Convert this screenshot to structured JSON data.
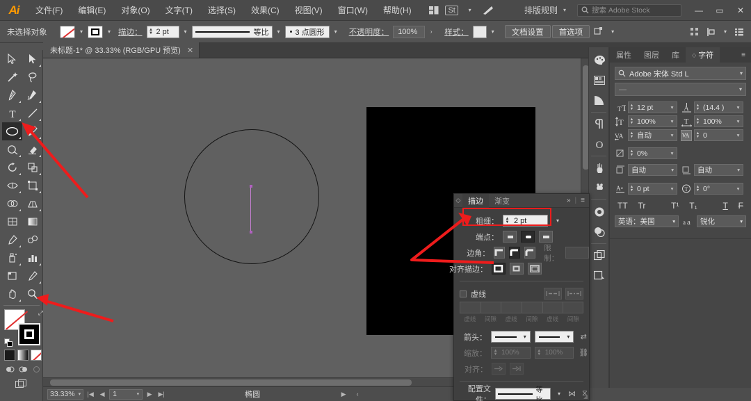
{
  "app": {
    "name": "Adobe Illustrator",
    "logo_text": "Ai"
  },
  "menubar": {
    "items": [
      {
        "label": "文件(F)"
      },
      {
        "label": "编辑(E)"
      },
      {
        "label": "对象(O)"
      },
      {
        "label": "文字(T)"
      },
      {
        "label": "选择(S)"
      },
      {
        "label": "效果(C)"
      },
      {
        "label": "视图(V)"
      },
      {
        "label": "窗口(W)"
      },
      {
        "label": "帮助(H)"
      }
    ],
    "workspace_icon": "arrange-documents-icon",
    "stock_icon": "stock-icon",
    "brush_icon": "brush-icon",
    "arrange_label": "排版规则",
    "search_placeholder": "搜索 Adobe Stock",
    "search_value": "",
    "window_controls": {
      "minimize": "—",
      "maximize": "▭",
      "close": "✕"
    }
  },
  "controlbar": {
    "selection_status": "未选择对象",
    "fill_label": "fill-none-swatch",
    "stroke_label": "stroke-black-swatch",
    "stroke_text": "描边：",
    "stroke_weight": "2 pt",
    "profile_label": "等比",
    "variable_width": "3 点圆形",
    "opacity_label": "不透明度：",
    "opacity_value": "100%",
    "style_label": "样式：",
    "doc_setup": "文档设置",
    "preferences": "首选项"
  },
  "document": {
    "tab_title": "未标题-1* @ 33.33% (RGB/GPU 预览)",
    "close_glyph": "✕"
  },
  "toolbar": {
    "tools": [
      {
        "name": "selection-tool",
        "active": false
      },
      {
        "name": "direct-selection-tool",
        "active": false
      },
      {
        "name": "magic-wand-tool",
        "active": false
      },
      {
        "name": "lasso-tool",
        "active": false
      },
      {
        "name": "pen-tool",
        "active": false
      },
      {
        "name": "curvature-tool",
        "active": false
      },
      {
        "name": "type-tool",
        "active": false
      },
      {
        "name": "line-segment-tool",
        "active": false
      },
      {
        "name": "ellipse-tool",
        "active": true
      },
      {
        "name": "paintbrush-tool",
        "active": false
      },
      {
        "name": "shaper-tool",
        "active": false
      },
      {
        "name": "eraser-tool",
        "active": false
      },
      {
        "name": "rotate-tool",
        "active": false
      },
      {
        "name": "scale-tool",
        "active": false
      },
      {
        "name": "width-tool",
        "active": false
      },
      {
        "name": "free-transform-tool",
        "active": false
      },
      {
        "name": "shape-builder-tool",
        "active": false
      },
      {
        "name": "perspective-grid-tool",
        "active": false
      },
      {
        "name": "mesh-tool",
        "active": false
      },
      {
        "name": "gradient-tool",
        "active": false
      },
      {
        "name": "eyedropper-tool",
        "active": false
      },
      {
        "name": "blend-tool",
        "active": false
      },
      {
        "name": "symbol-sprayer-tool",
        "active": false
      },
      {
        "name": "column-graph-tool",
        "active": false
      },
      {
        "name": "artboard-tool",
        "active": false
      },
      {
        "name": "slice-tool",
        "active": false
      },
      {
        "name": "hand-tool",
        "active": false
      },
      {
        "name": "zoom-tool",
        "active": false
      }
    ],
    "fill_swatch": "none",
    "stroke_swatch": "#000000",
    "color_modes": [
      "color-swatch",
      "gradient-swatch",
      "none-swatch"
    ],
    "screen_modes": [
      "draw-normal",
      "draw-behind",
      "draw-inside"
    ],
    "screen_mode_icon": "change-screen-mode-icon"
  },
  "canvas": {
    "artboard_color": "#000000",
    "circle_stroke": "#141414",
    "guide_color": "#c47fd0",
    "background": "#606060"
  },
  "statusbar": {
    "zoom_value": "33.33%",
    "page_value": "1",
    "current_tool": "椭圆",
    "first_glyph": "|◀",
    "prev_glyph": "◀",
    "next_glyph": "▶",
    "last_glyph": "▶|"
  },
  "stroke_panel": {
    "tab_active": "描边",
    "tab_inactive": "渐变",
    "collapse_glyph": "»",
    "menu_glyph": "≡",
    "weight_label": "粗细：",
    "weight_value": "2 pt",
    "cap_label": "端点：",
    "corner_label": "边角：",
    "limit_label": "限制：",
    "limit_value": "",
    "align_label": "对齐描边：",
    "dashed_label": "虚线",
    "dash_fields": [
      "虚线",
      "间隙",
      "虚线",
      "间隙",
      "虚线",
      "间隙"
    ],
    "arrows_label": "箭头：",
    "scale_label": "缩放：",
    "scale_value_1": "100%",
    "scale_value_2": "100%",
    "align_arrow_label": "对齐：",
    "profile_label": "配置文件：",
    "profile_value": "等比"
  },
  "right_panel": {
    "tabs": [
      {
        "label": "属性",
        "active": false
      },
      {
        "label": "图层",
        "active": false
      },
      {
        "label": "库",
        "active": false
      },
      {
        "label": "字符",
        "active": true
      }
    ],
    "menu_glyph": "≡",
    "font_family": "Adobe 宋体 Std L",
    "font_style": "—",
    "fields": [
      {
        "icon": "font-size-icon",
        "value": "12 pt"
      },
      {
        "icon": "leading-icon",
        "value": "(14.4 )"
      },
      {
        "icon": "vertical-scale-icon",
        "value": "100%"
      },
      {
        "icon": "horizontal-scale-icon",
        "value": "100%"
      },
      {
        "icon": "kerning-icon",
        "value": "自动"
      },
      {
        "icon": "tracking-icon",
        "value": "0"
      },
      {
        "icon": "tsume-icon",
        "value": "0%"
      }
    ],
    "auto_fields": [
      {
        "icon": "vertical-align-icon",
        "value": "自动"
      },
      {
        "icon": "warichu-icon",
        "value": "自动"
      }
    ],
    "baseline": {
      "icon": "baseline-shift-icon",
      "value": "0 pt"
    },
    "rotation": {
      "icon": "character-rotation-icon",
      "value": "0°"
    },
    "style_buttons": [
      "TT",
      "Tr",
      "T¹",
      "T₁",
      "T",
      "F"
    ],
    "language_label": "英语：美国",
    "antialias_icon": "anti-aliasing-icon",
    "antialias_value": "锐化"
  },
  "dock_rail": {
    "icons": [
      "color-icon",
      "color-guide-icon",
      "gradient-icon",
      "paragraph-icon",
      "glyphs-icon",
      "brushes-icon",
      "symbols-icon",
      "transparency-icon",
      "appearance-icon",
      "artboards-icon",
      "asset-export-icon"
    ]
  },
  "annotations": {
    "highlight_color": "#ee1c1c",
    "arrow_count": 3
  }
}
